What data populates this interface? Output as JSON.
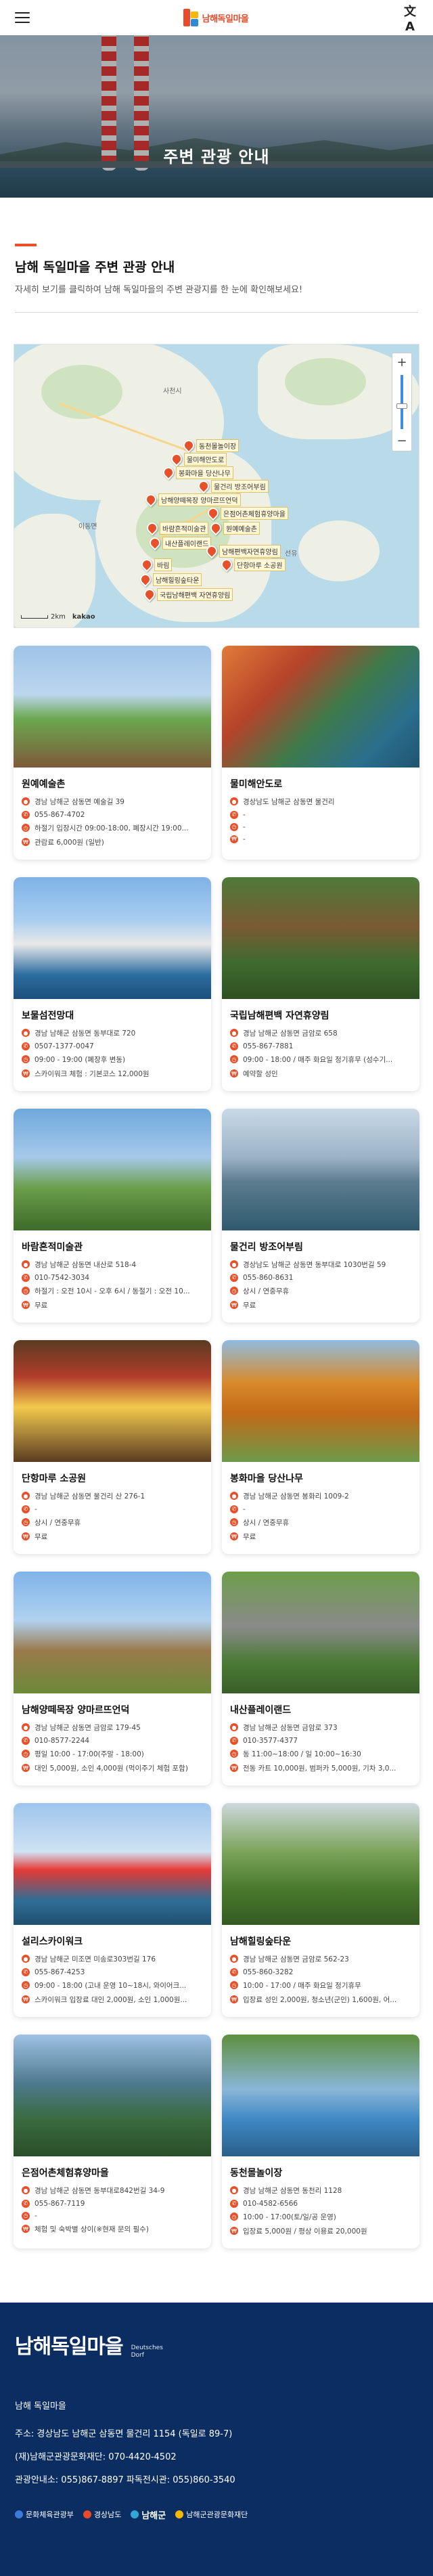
{
  "header": {
    "logo_text": "남해독일마을",
    "menu_icon": "hamburger-menu-icon",
    "lang_icon_glyph": "文A"
  },
  "hero": {
    "title": "주변 관광 안내"
  },
  "intro": {
    "heading": "남해 독일마을 주변 관광 안내",
    "description": "자세히 보기를 클릭하여 남해 독일마을의 주변 관광지를 한 눈에 확인해보세요!"
  },
  "map": {
    "zoom_in": "+",
    "zoom_out": "−",
    "scale_label": "2km",
    "attribution": "kakao",
    "place_labels": [
      "이동면",
      "사천시",
      "선유"
    ],
    "markers": [
      "동천몰놀이장",
      "물미해안도로",
      "봉화마을 당산나무",
      "물건리 방조어부림",
      "남해양떼목장 양마르뜨언덕",
      "은점어촌체험휴양마을",
      "원예예술촌",
      "바람흔적미술관",
      "내산플레이랜드",
      "남해편백자연휴양림",
      "단항마루 소공원",
      "바림",
      "남해힐링숲타운",
      "국립남해편백 자연휴양림"
    ]
  },
  "cards": [
    {
      "title": "원예예술촌",
      "address": "경남 남해군 삼동면 예술길 39",
      "phone": "055-867-4702",
      "hours": "하절기 입장시간 09:00-18:00, 폐장시간 19:00...",
      "fee": "관람료 6,000원 (일반)"
    },
    {
      "title": "물미해안도로",
      "address": "경상남도 남해군 삼동면 물건리",
      "phone": "-",
      "hours": "-",
      "fee": "-"
    },
    {
      "title": "보물섬전망대",
      "address": "경남 남해군 삼동면 동부대로 720",
      "phone": "0507-1377-0047",
      "hours": "09:00 - 19:00 (폐장후 변동)",
      "fee": "스카이워크 체험 : 기본코스 12,000원"
    },
    {
      "title": "국립남해편백 자연휴양림",
      "address": "경남 남해군 삼동면 금암로 658",
      "phone": "055-867-7881",
      "hours": "09:00 - 18:00 / 매주 화요일 정기휴무 (성수기...",
      "fee": "예약할 성인"
    },
    {
      "title": "바람흔적미술관",
      "address": "경남 남해군 삼동면 내산로 518-4",
      "phone": "010-7542-3034",
      "hours": "하절기 : 오전 10시 - 오후 6시 / 동절기 : 오전 10...",
      "fee": "무료"
    },
    {
      "title": "물건리 방조어부림",
      "address": "경상남도 남해군 삼동면 동부대로 1030번길 59",
      "phone": "055-860-8631",
      "hours": "상시 / 연중무휴",
      "fee": "무료"
    },
    {
      "title": "단항마루 소공원",
      "address": "경남 남해군 삼동면 물건리 산 276-1",
      "phone": "-",
      "hours": "상시 / 연중무휴",
      "fee": "무료"
    },
    {
      "title": "봉화마을 당산나무",
      "address": "경남 남해군 삼동면 봉화리 1009-2",
      "phone": "-",
      "hours": "상시 / 연중무휴",
      "fee": "무료"
    },
    {
      "title": "남해양떼목장 양마르뜨언덕",
      "address": "경남 남해군 삼동면 금암로 179-45",
      "phone": "010-8577-2244",
      "hours": "평일 10:00 - 17:00(주말 - 18:00)",
      "fee": "대인 5,000원, 소인 4,000원 (먹이주기 체험 포함)"
    },
    {
      "title": "내산플레이랜드",
      "address": "경남 남해군 삼동면 금암로 373",
      "phone": "010-3577-4377",
      "hours": "동 11:00~18:00 / 일 10:00~16:30",
      "fee": "전동 카트 10,000원, 범퍼카 5,000원, 기차 3,0..."
    },
    {
      "title": "설리스카이워크",
      "address": "경남 남해군 미조면 미송로303번길 176",
      "phone": "055-867-4253",
      "hours": "09:00 - 18:00 (고내 운영 10~18시, 와이어크...",
      "fee": "스카이워크 입장료 대인 2,000원, 소인 1,000원..."
    },
    {
      "title": "남해힐링숲타운",
      "address": "경남 남해군 삼동면 금암로 562-23",
      "phone": "055-860-3282",
      "hours": "10:00 - 17:00 / 매주 화요일 정기휴무",
      "fee": "입장료 성인 2,000원, 청소년(군인) 1,600원, 어..."
    },
    {
      "title": "은점어촌체험휴양마을",
      "address": "경남 남해군 삼동면 동부대로842번길 34-9",
      "phone": "055-867-7119",
      "hours": "-",
      "fee": "체험 및 숙박별 상이(※현재 문의 필수)"
    },
    {
      "title": "동천몰놀이장",
      "address": "경남 남해군 삼동면 동천리 1128",
      "phone": "010-4582-6566",
      "hours": "10:00 - 17:00(토/일/공 운영)",
      "fee": "입장료 5,000원 / 평상 이용료 20,000원"
    }
  ],
  "footer": {
    "logo_text": "남해독일마을",
    "logo_sub_1": "Deutsches",
    "logo_sub_2": "Dorf",
    "name": "남해 독일마을",
    "address": "주소: 경상남도 남해군 삼동면 물건리 1154 (독일로 89-7)",
    "org": "(재)남해군관광문화재단: 070-4420-4502",
    "info": "관광안내소: 055)867-8897  파독전시관: 055)860-3540",
    "partners": [
      "문화체육관광부",
      "경상남도",
      "남해군",
      "남해군관광문화재단"
    ]
  }
}
